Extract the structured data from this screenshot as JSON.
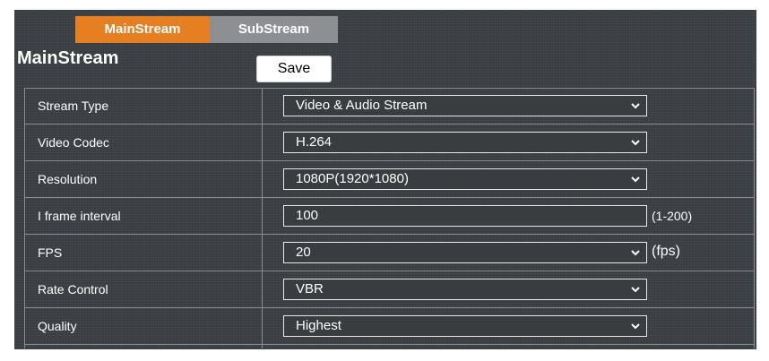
{
  "tabs": {
    "main": "MainStream",
    "sub": "SubStream",
    "active": "main"
  },
  "section_title": "MainStream",
  "save_label": "Save",
  "colors": {
    "active_tab": "#e67e22",
    "inactive_tab": "#8d8f92",
    "panel": "#3c3f43"
  },
  "rows": [
    {
      "label": "Stream Type",
      "value": "Video & Audio Stream",
      "control": "select"
    },
    {
      "label": "Video Codec",
      "value": "H.264",
      "control": "select"
    },
    {
      "label": "Resolution",
      "value": "1080P(1920*1080)",
      "control": "select"
    },
    {
      "label": "I frame interval",
      "value": "100",
      "control": "input",
      "suffix": "(1-200)"
    },
    {
      "label": "FPS",
      "value": "20",
      "control": "select",
      "suffix": "(fps)"
    },
    {
      "label": "Rate Control",
      "value": "VBR",
      "control": "select"
    },
    {
      "label": "Quality",
      "value": "Highest",
      "control": "select"
    }
  ]
}
